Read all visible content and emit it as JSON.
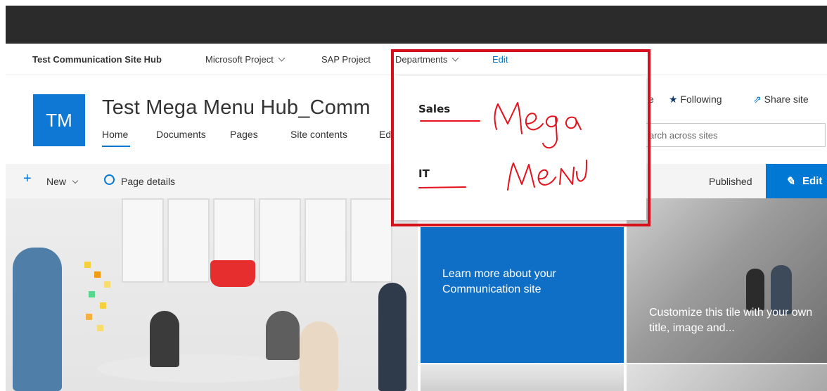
{
  "hub_nav": {
    "title": "Test Communication Site Hub",
    "items": [
      {
        "label": "Microsoft Project",
        "has_dropdown": true
      },
      {
        "label": "SAP Project",
        "has_dropdown": false
      },
      {
        "label": "Departments",
        "has_dropdown": true
      }
    ],
    "edit_label": "Edit"
  },
  "site": {
    "logo_text": "TM",
    "title": "Test Mega Menu Hub_Comm",
    "nav": [
      "Home",
      "Documents",
      "Pages",
      "Site contents",
      "Ed"
    ],
    "following_label": "Following",
    "share_label": "Share site",
    "left_cut_label": "e",
    "search_placeholder": "arch across sites"
  },
  "command_bar": {
    "new_label": "New",
    "page_details_label": "Page details",
    "status": "Published",
    "edit_label": "Edit"
  },
  "mega_menu": {
    "headings": [
      "Sales",
      "IT"
    ],
    "annotation": [
      "Mega",
      "Menu"
    ]
  },
  "tiles": {
    "blue_text": "Learn more about your Communication site",
    "right_text": "Customize this tile with your own title, image and..."
  },
  "colors": {
    "accent": "#0078d4",
    "suite_bar": "#2b2b2b",
    "annotation_red": "#d5101c",
    "tile_blue": "#0f6fc6"
  }
}
